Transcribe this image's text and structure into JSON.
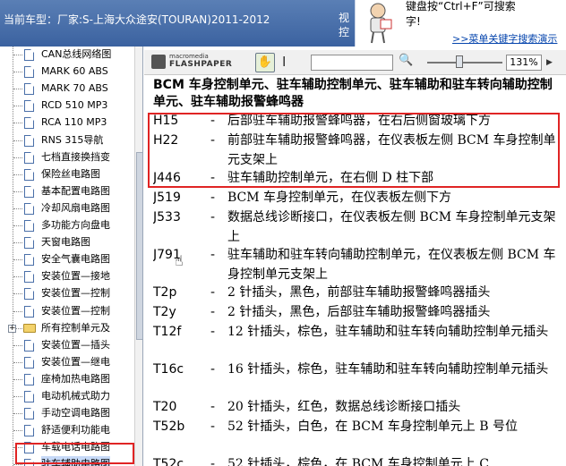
{
  "header": {
    "car_label": "当前车型：厂家:S-上海大众途安(TOURAN)2011-2012",
    "cut_label": "视控"
  },
  "hint": {
    "line1": "键盘按“Ctrl+F”可搜索",
    "line2": "字!",
    "link": ">>菜单关键字搜索演示"
  },
  "tree": {
    "items": [
      {
        "label": "CAN总线网络图",
        "type": "doc"
      },
      {
        "label": "MARK 60 ABS",
        "type": "doc"
      },
      {
        "label": "MARK 70 ABS",
        "type": "doc"
      },
      {
        "label": "RCD 510 MP3",
        "type": "doc"
      },
      {
        "label": "RCA 110 MP3",
        "type": "doc"
      },
      {
        "label": "RNS 315导航",
        "type": "doc"
      },
      {
        "label": "七档直接换挡变",
        "type": "doc"
      },
      {
        "label": "保险丝电路图",
        "type": "doc"
      },
      {
        "label": "基本配置电路图",
        "type": "doc"
      },
      {
        "label": "冷却风扇电路图",
        "type": "doc"
      },
      {
        "label": "多功能方向盘电",
        "type": "doc"
      },
      {
        "label": "天窗电路图",
        "type": "doc"
      },
      {
        "label": "安全气囊电路图",
        "type": "doc"
      },
      {
        "label": "安装位置—接地",
        "type": "doc"
      },
      {
        "label": "安装位置—控制",
        "type": "doc"
      },
      {
        "label": "安装位置—控制",
        "type": "doc"
      },
      {
        "label": "所有控制单元及",
        "type": "folder"
      },
      {
        "label": "安装位置—插头",
        "type": "doc"
      },
      {
        "label": "安装位置—继电",
        "type": "doc"
      },
      {
        "label": "座椅加热电路图",
        "type": "doc"
      },
      {
        "label": "电动机械式助力",
        "type": "doc"
      },
      {
        "label": "手动空调电路图",
        "type": "doc"
      },
      {
        "label": "舒适便利功能电",
        "type": "doc"
      },
      {
        "label": "车载电话电路图",
        "type": "doc"
      },
      {
        "label": "驻车辅助电路图",
        "type": "doc",
        "selected": true
      }
    ]
  },
  "viewer": {
    "logo_top": "macromedia",
    "logo_bottom": "FLASHPAPER",
    "zoom": "131%"
  },
  "document": {
    "title": "BCM 车身控制单元、驻车辅助控制单元、驻车辅助和驻车转向辅助控制单元、驻车辅助报警蜂鸣器",
    "entries": [
      {
        "code": "H15",
        "dash": "-",
        "desc": "后部驻车辅助报警蜂鸣器，在右后侧窗玻璃下方"
      },
      {
        "code": "H22",
        "dash": "-",
        "desc": "前部驻车辅助报警蜂鸣器，在仪表板左侧 BCM 车身控制单元支架上"
      },
      {
        "code": "J446",
        "dash": "-",
        "desc": "驻车辅助控制单元，在右侧 D 柱下部"
      },
      {
        "code": "J519",
        "dash": "-",
        "desc": "BCM 车身控制单元，在仪表板左侧下方"
      },
      {
        "code": "J533",
        "dash": "-",
        "desc": "数据总线诊断接口，在仪表板左侧 BCM 车身控制单元支架上"
      },
      {
        "code": "J791",
        "dash": "-",
        "desc": "驻车辅助和驻车转向辅助控制单元，在仪表板左侧 BCM 车身控制单元支架上"
      },
      {
        "code": "T2p",
        "dash": "-",
        "desc": "2 针插头，黑色，前部驻车辅助报警蜂鸣器插头"
      },
      {
        "code": "T2y",
        "dash": "-",
        "desc": "2 针插头，黑色，后部驻车辅助报警蜂鸣器插头"
      },
      {
        "code": "T12f",
        "dash": "-",
        "desc": "12 针插头，棕色，驻车辅助和驻车转向辅助控制单元插头"
      },
      {
        "code": "T16c",
        "dash": "-",
        "desc": "16 针插头，棕色，驻车辅助和驻车转向辅助控制单元插头"
      },
      {
        "code": "T20",
        "dash": "-",
        "desc": "20 针插头，红色，数据总线诊断接口插头"
      },
      {
        "code": "T52b",
        "dash": "-",
        "desc": "52 针插头，白色，在 BCM 车身控制单元上 B 号位"
      },
      {
        "code": "T52c",
        "dash": "-",
        "desc": "52 针插头，棕色，在 BCM 车身控制单元上 C"
      }
    ]
  },
  "colors": {
    "header_bg": "#3b62a0",
    "highlight": "#e02424",
    "selection": "#c6d9f7"
  }
}
